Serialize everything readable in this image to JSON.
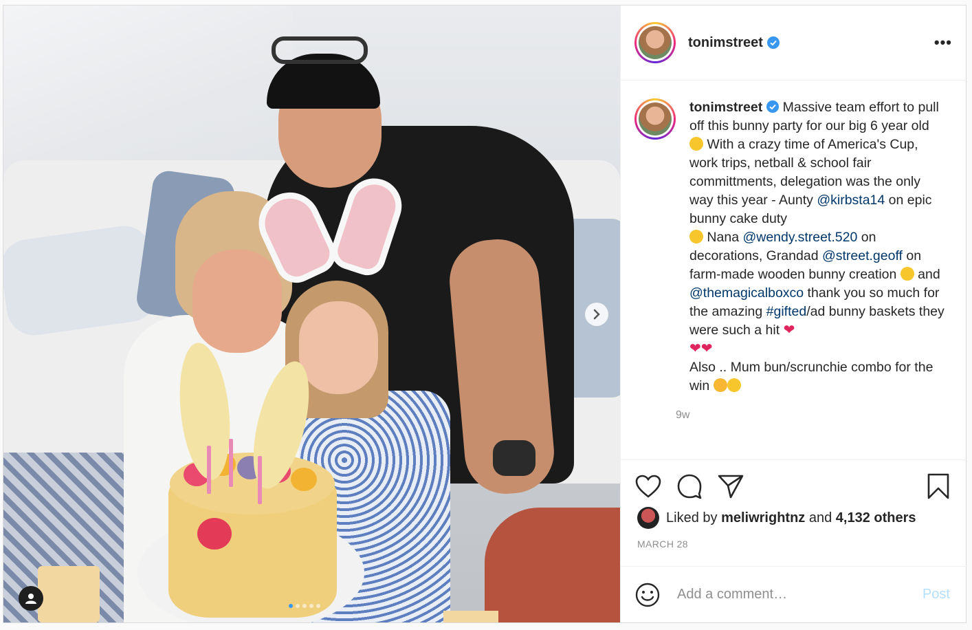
{
  "post": {
    "username": "tonimstreet",
    "more_label": "•••",
    "caption_parts": {
      "p1": " Massive team effort to pull off this bunny party for our big 6 year old ",
      "p2": " With a crazy time of America's Cup, work trips, netball & school fair committments, delegation was the only way this year - Aunty ",
      "m1": "@kirbsta14",
      "p3": " on epic bunny cake duty ",
      "p4": " Nana ",
      "m2": "@wendy.street.520",
      "p5": " on decorations, Grandad ",
      "m3": "@street.geoff",
      "p6": " on farm-made wooden bunny creation ",
      "p7": " and ",
      "m4": "@themagicalboxco",
      "p8": " thank you so much for the amazing ",
      "m5": "#gifted",
      "p9": "/ad bunny baskets they were such a hit ",
      "p10": "Also .. Mum bun/scrunchie combo for the win "
    },
    "time_ago": "9w",
    "liked_by_prefix": "Liked by ",
    "liked_by_user": "meliwrightnz",
    "liked_by_middle": " and ",
    "liked_by_count": "4,132 others",
    "date": "MARCH 28",
    "comment_placeholder": "Add a comment…",
    "post_button": "Post"
  },
  "icons": {
    "verified": "verified-badge-icon",
    "like": "heart-icon",
    "comment": "comment-icon",
    "share": "paper-plane-icon",
    "save": "bookmark-icon",
    "emoji": "smiley-icon",
    "next": "chevron-right-icon",
    "tag": "user-tag-icon"
  },
  "colors": {
    "link": "#00376b",
    "verified": "#3897f0",
    "muted": "#8e8e8e",
    "post_disabled": "#b2dffc"
  },
  "carousel": {
    "slides": 5,
    "active": 1
  }
}
